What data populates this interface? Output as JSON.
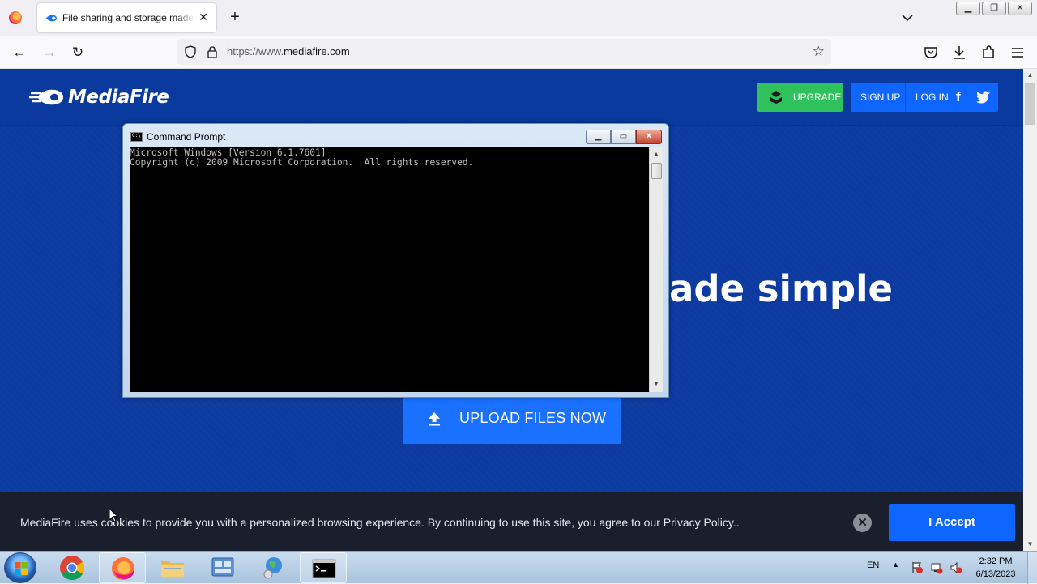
{
  "browser": {
    "tab_title": "File sharing and storage made simple",
    "url_prefix": "https://www.",
    "url_domain": "mediafire.com",
    "close_glyph": "✕",
    "newtab_glyph": "+"
  },
  "page": {
    "logo_text": "MediaFire",
    "nav": {
      "upgrade": "UPGRADE",
      "signup": "SIGN UP",
      "login": "LOG IN",
      "facebook": "f"
    },
    "headline_visible": "ade simple",
    "upload_button": "UPLOAD FILES NOW",
    "cookie": {
      "text": "MediaFire uses cookies to provide you with a personalized browsing experience. By continuing to use this site, you agree to our Privacy Policy..",
      "close": "✕",
      "accept": "I Accept"
    },
    "colors": {
      "brand_blue": "#0a3a9d",
      "button_blue": "#0f66ff",
      "upgrade_green": "#2fc15b"
    }
  },
  "cmd": {
    "title": "Command Prompt",
    "line1": "Microsoft Windows [Version 6.1.7601]",
    "line2": "Copyright (c) 2009 Microsoft Corporation.  All rights reserved."
  },
  "taskbar": {
    "apps": [
      "chrome-icon",
      "firefox-icon",
      "file-explorer-icon",
      "control-panel-icon",
      "network-globe-icon",
      "command-prompt-icon"
    ],
    "lang": "EN",
    "time": "2:32 PM",
    "date": "6/13/2023"
  }
}
